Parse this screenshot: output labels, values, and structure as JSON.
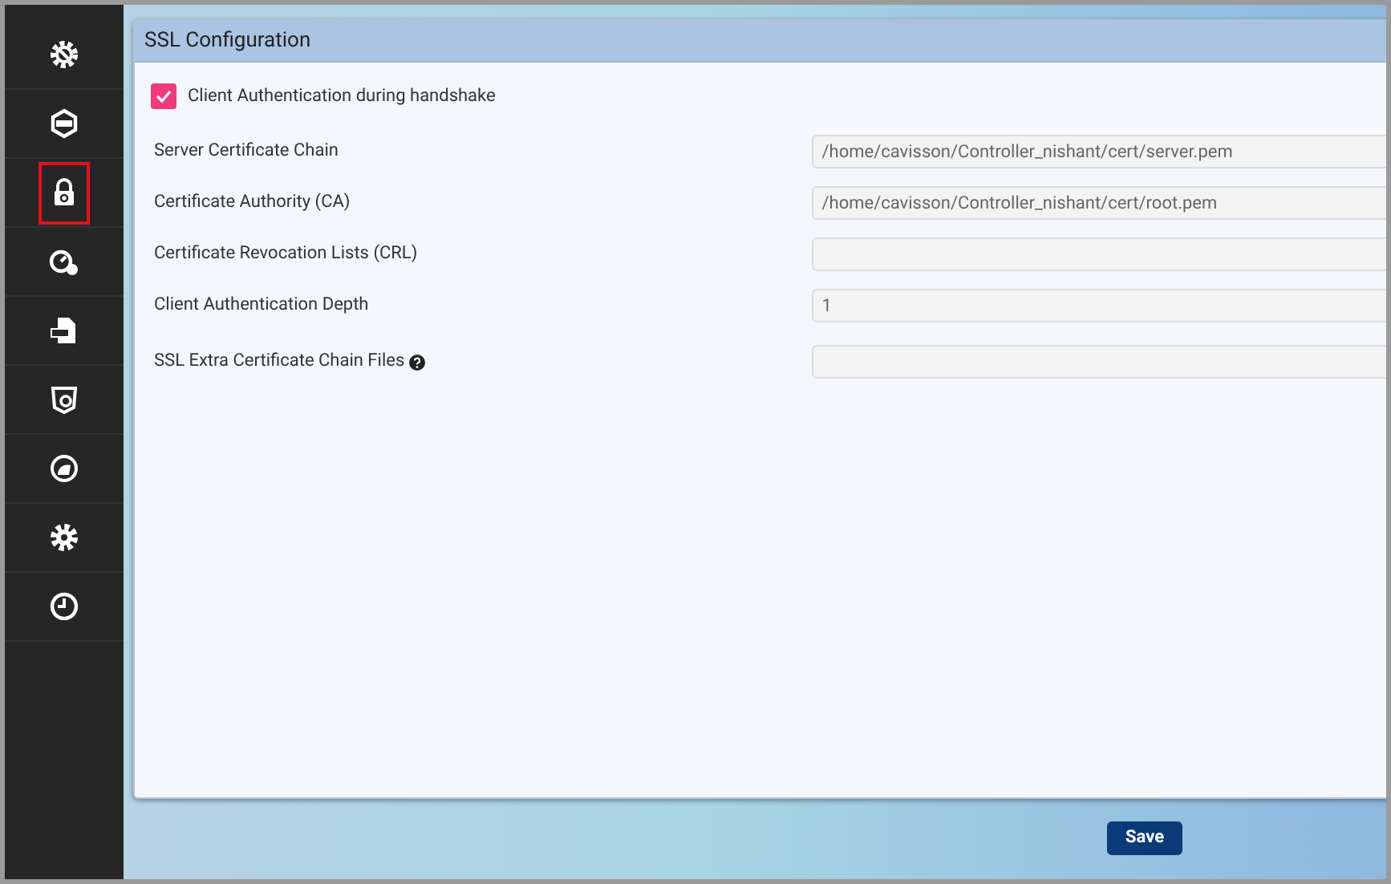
{
  "sidebar": {
    "items": [
      {
        "selected": false
      },
      {
        "selected": false
      },
      {
        "selected": true
      },
      {
        "selected": false
      },
      {
        "selected": false
      },
      {
        "selected": false
      },
      {
        "selected": false
      },
      {
        "selected": false
      },
      {
        "selected": false
      }
    ]
  },
  "panel": {
    "title": "SSL Configuration",
    "checkbox": {
      "label": "Client Authentication during handshake",
      "checked": true
    },
    "fields": [
      {
        "label": "Server Certificate Chain",
        "value": "/home/cavisson/Controller_nishant/cert/server.pem",
        "help": false
      },
      {
        "label": "Certificate Authority (CA)",
        "value": "/home/cavisson/Controller_nishant/cert/root.pem",
        "help": false
      },
      {
        "label": "Certificate Revocation Lists (CRL)",
        "help": false
      },
      {
        "label": "Client Authentication Depth",
        "value": "1",
        "help": false
      },
      {
        "label": "SSL Extra Certificate Chain Files",
        "help": true
      }
    ]
  },
  "save_button": "Save"
}
